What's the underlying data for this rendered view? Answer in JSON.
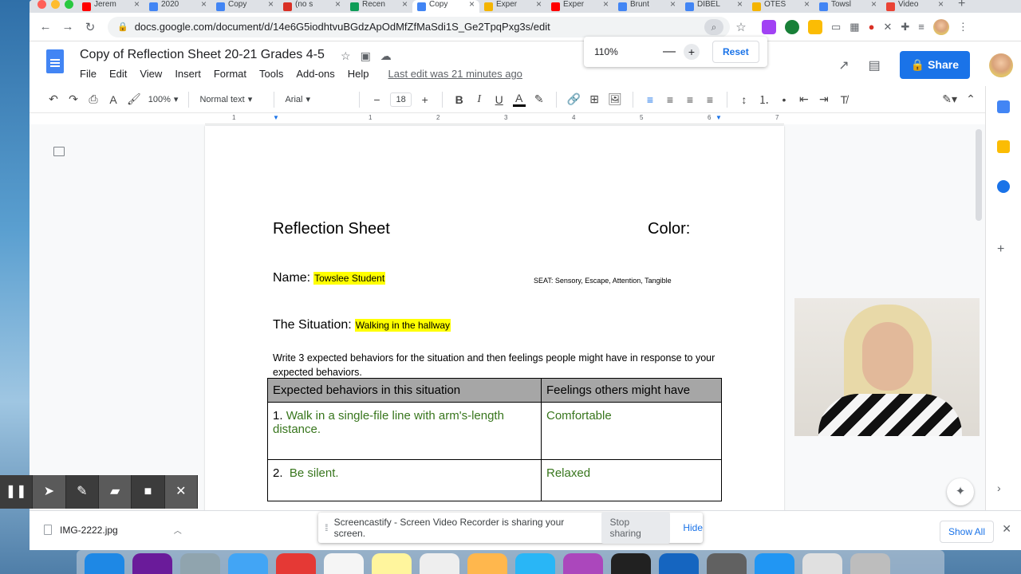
{
  "browser": {
    "tabs": [
      {
        "label": "Jerem",
        "color": "#ff0000"
      },
      {
        "label": "2020",
        "color": "#4285f4"
      },
      {
        "label": "Copy",
        "color": "#4285f4"
      },
      {
        "label": "(no s",
        "color": "#d93025"
      },
      {
        "label": "Recen",
        "color": "#0f9d58"
      },
      {
        "label": "Copy",
        "color": "#4285f4",
        "active": true
      },
      {
        "label": "Exper",
        "color": "#f4b400"
      },
      {
        "label": "Exper",
        "color": "#ff0000"
      },
      {
        "label": "Brunt",
        "color": "#4285f4"
      },
      {
        "label": "DIBEL",
        "color": "#4285f4"
      },
      {
        "label": "OTES",
        "color": "#f4b400"
      },
      {
        "label": "Towsl",
        "color": "#4285f4"
      },
      {
        "label": "Video",
        "color": "#ea4335"
      }
    ],
    "url": "docs.google.com/document/d/14e6G5iodhtvuBGdzApOdMfZfMaSdi1S_Ge2TpqPxg3s/edit"
  },
  "docs": {
    "title": "Copy of Reflection Sheet 20-21 Grades 4-5",
    "menu": [
      "File",
      "Edit",
      "View",
      "Insert",
      "Format",
      "Tools",
      "Add-ons",
      "Help"
    ],
    "last_edit": "Last edit was 21 minutes ago",
    "share_label": "Share"
  },
  "zoom_popup": {
    "level": "110%",
    "minus": "—",
    "plus": "+",
    "reset": "Reset"
  },
  "toolbar": {
    "zoom": "100%",
    "style": "Normal text",
    "font": "Arial",
    "font_size": "18"
  },
  "ruler": {
    "marks": [
      "1",
      "1",
      "2",
      "3",
      "4",
      "5",
      "6",
      "7"
    ]
  },
  "document": {
    "heading": "Reflection Sheet",
    "color_label": "Color:",
    "name_label": "Name:",
    "name_value": "Towslee Student",
    "seat_text": "SEAT: Sensory, Escape, Attention, Tangible",
    "situation_label": "The Situation:",
    "situation_value": "Walking in the hallway",
    "instructions": "Write 3 expected behaviors for the situation and then feelings people might have in response to your expected behaviors.",
    "table": {
      "headers": [
        "Expected behaviors in this situation",
        "Feelings others might have"
      ],
      "rows": [
        {
          "num": "1.",
          "behavior": "Walk in a single-file line with arm's-length distance.",
          "feeling": "Comfortable"
        },
        {
          "num": "2.",
          "behavior": "Be silent.",
          "feeling": "Relaxed"
        }
      ]
    }
  },
  "download": {
    "filename": "IMG-2222.jpg",
    "show_all": "Show All"
  },
  "share_banner": {
    "message": "Screencastify - Screen Video Recorder is sharing your screen.",
    "stop": "Stop sharing",
    "hide": "Hide"
  }
}
